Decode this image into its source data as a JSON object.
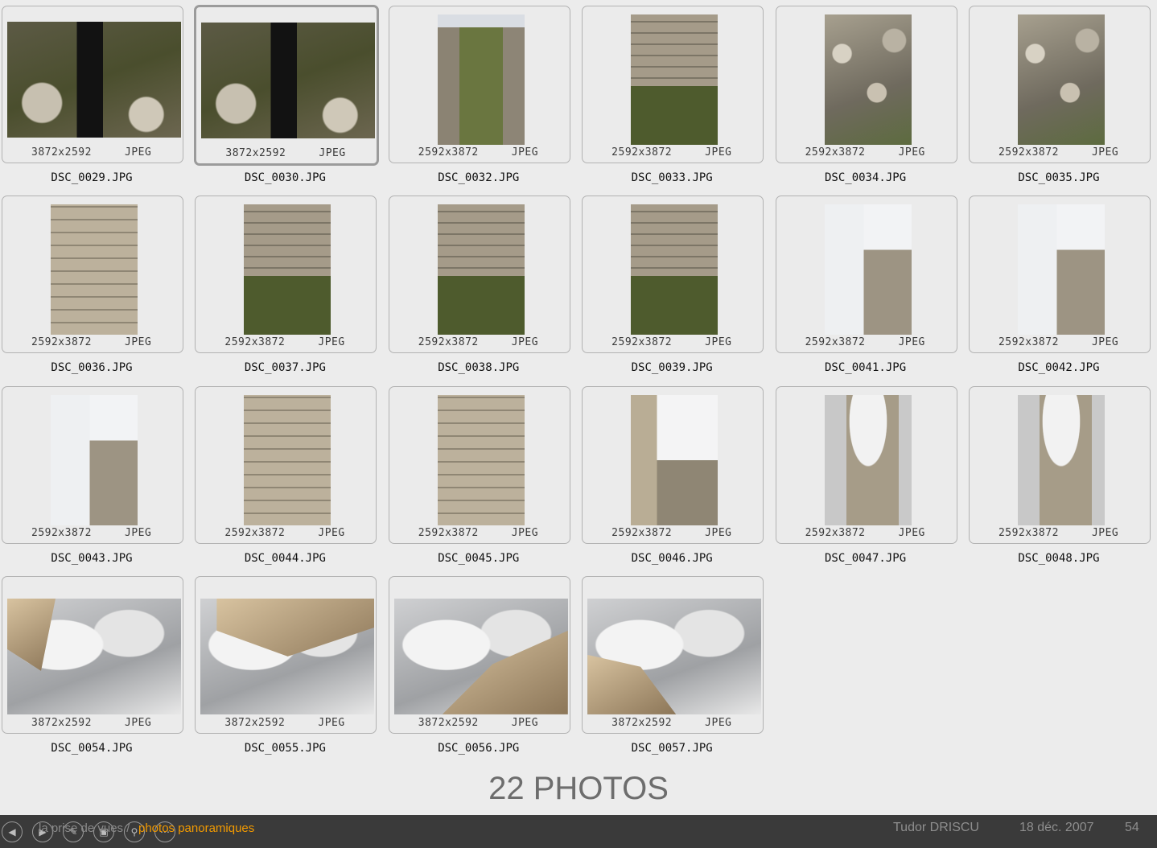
{
  "photos": [
    {
      "name": "DSC_0029.JPG",
      "dims": "3872x2592",
      "format": "JPEG",
      "orientation": "landscape",
      "thumb": "tripod",
      "selected": false
    },
    {
      "name": "DSC_0030.JPG",
      "dims": "3872x2592",
      "format": "JPEG",
      "orientation": "landscape",
      "thumb": "tripod",
      "selected": true
    },
    {
      "name": "DSC_0032.JPG",
      "dims": "2592x3872",
      "format": "JPEG",
      "orientation": "portrait",
      "thumb": "path",
      "selected": false
    },
    {
      "name": "DSC_0033.JPG",
      "dims": "2592x3872",
      "format": "JPEG",
      "orientation": "portrait",
      "thumb": "wallgrass",
      "selected": false
    },
    {
      "name": "DSC_0034.JPG",
      "dims": "2592x3872",
      "format": "JPEG",
      "orientation": "portrait",
      "thumb": "rock",
      "selected": false
    },
    {
      "name": "DSC_0035.JPG",
      "dims": "2592x3872",
      "format": "JPEG",
      "orientation": "portrait",
      "thumb": "rock",
      "selected": false
    },
    {
      "name": "DSC_0036.JPG",
      "dims": "2592x3872",
      "format": "JPEG",
      "orientation": "portrait",
      "thumb": "wall",
      "selected": false
    },
    {
      "name": "DSC_0037.JPG",
      "dims": "2592x3872",
      "format": "JPEG",
      "orientation": "portrait",
      "thumb": "wallgrass",
      "selected": false
    },
    {
      "name": "DSC_0038.JPG",
      "dims": "2592x3872",
      "format": "JPEG",
      "orientation": "portrait",
      "thumb": "wallgrass",
      "selected": false
    },
    {
      "name": "DSC_0039.JPG",
      "dims": "2592x3872",
      "format": "JPEG",
      "orientation": "portrait",
      "thumb": "wallgrass",
      "selected": false
    },
    {
      "name": "DSC_0041.JPG",
      "dims": "2592x3872",
      "format": "JPEG",
      "orientation": "portrait",
      "thumb": "skywall",
      "selected": false
    },
    {
      "name": "DSC_0042.JPG",
      "dims": "2592x3872",
      "format": "JPEG",
      "orientation": "portrait",
      "thumb": "skywall",
      "selected": false
    },
    {
      "name": "DSC_0043.JPG",
      "dims": "2592x3872",
      "format": "JPEG",
      "orientation": "portrait",
      "thumb": "skywall",
      "selected": false
    },
    {
      "name": "DSC_0044.JPG",
      "dims": "2592x3872",
      "format": "JPEG",
      "orientation": "portrait",
      "thumb": "wall",
      "selected": false
    },
    {
      "name": "DSC_0045.JPG",
      "dims": "2592x3872",
      "format": "JPEG",
      "orientation": "portrait",
      "thumb": "wall",
      "selected": false
    },
    {
      "name": "DSC_0046.JPG",
      "dims": "2592x3872",
      "format": "JPEG",
      "orientation": "portrait",
      "thumb": "skywall2",
      "selected": false
    },
    {
      "name": "DSC_0047.JPG",
      "dims": "2592x3872",
      "format": "JPEG",
      "orientation": "portrait",
      "thumb": "tower",
      "selected": false
    },
    {
      "name": "DSC_0048.JPG",
      "dims": "2592x3872",
      "format": "JPEG",
      "orientation": "portrait",
      "thumb": "tower",
      "selected": false
    },
    {
      "name": "DSC_0054.JPG",
      "dims": "3872x2592",
      "format": "JPEG",
      "orientation": "landscape",
      "thumb": "sky",
      "selected": false
    },
    {
      "name": "DSC_0055.JPG",
      "dims": "3872x2592",
      "format": "JPEG",
      "orientation": "landscape",
      "thumb": "sky",
      "selected": false
    },
    {
      "name": "DSC_0056.JPG",
      "dims": "3872x2592",
      "format": "JPEG",
      "orientation": "landscape",
      "thumb": "sky",
      "selected": false
    },
    {
      "name": "DSC_0057.JPG",
      "dims": "3872x2592",
      "format": "JPEG",
      "orientation": "landscape",
      "thumb": "sky",
      "selected": false
    }
  ],
  "count_label": "22 PHOTOS",
  "footer": {
    "breadcrumb_1": "la prise de vues /",
    "breadcrumb_2": "photos panoramiques",
    "author": "Tudor DRISCU",
    "date": "18 déc. 2007",
    "page": "54",
    "nav_icons": [
      "prev-icon",
      "play-icon",
      "pen-icon",
      "overview-icon",
      "zoom-icon",
      "more-icon"
    ]
  },
  "colors": {
    "background": "#ececec",
    "footer_bg": "#3a3a3a",
    "breadcrumb_accent": "#f29a00",
    "selected_border": "#9b9b9b"
  }
}
